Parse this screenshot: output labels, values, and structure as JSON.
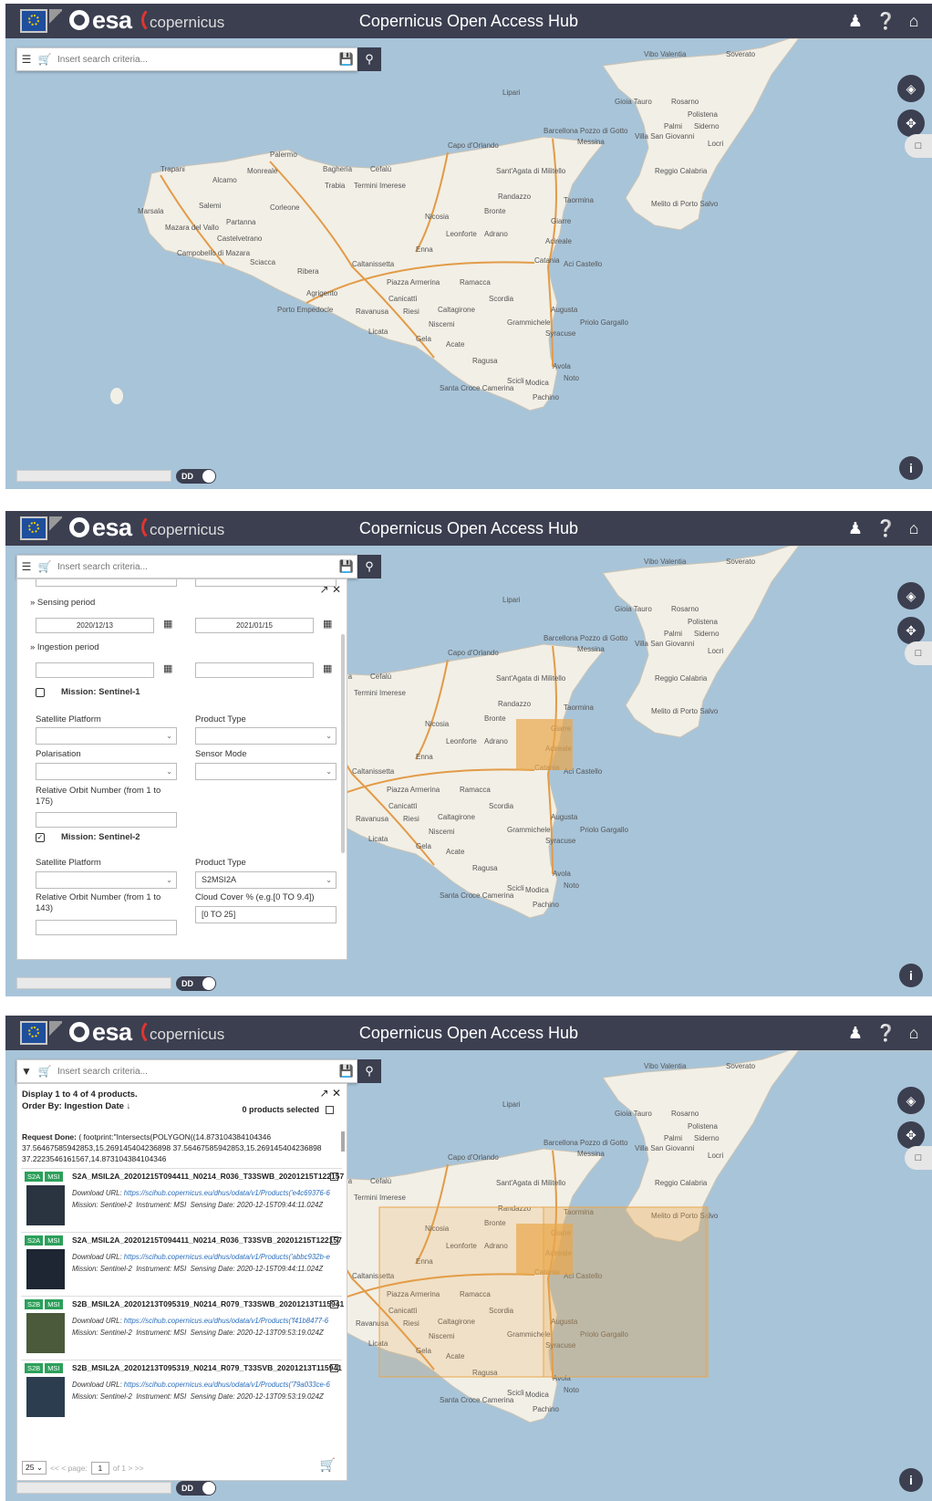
{
  "header": {
    "esa_label": "esa",
    "copernicus_label": "opernicus",
    "title": "Copernicus Open Access Hub"
  },
  "search": {
    "placeholder": "Insert search criteria..."
  },
  "toggle": {
    "label": "DD"
  },
  "map_labels": [
    {
      "t": "Vibo Valentia"
    },
    {
      "t": "Soverato"
    },
    {
      "t": "Lipari"
    },
    {
      "t": "Gioia Tauro"
    },
    {
      "t": "Rosarno"
    },
    {
      "t": "Polistena"
    },
    {
      "t": "Palmi"
    },
    {
      "t": "Siderno"
    },
    {
      "t": "Villa San Giovanni"
    },
    {
      "t": "Locri"
    },
    {
      "t": "Messina"
    },
    {
      "t": "Barcellona Pozzo di Gotto"
    },
    {
      "t": "Capo d'Orlando"
    },
    {
      "t": "Palermo"
    },
    {
      "t": "Bagheria"
    },
    {
      "t": "Cefalù"
    },
    {
      "t": "Trapani"
    },
    {
      "t": "Monreale"
    },
    {
      "t": "Alcamo"
    },
    {
      "t": "Trabia"
    },
    {
      "t": "Termini Imerese"
    },
    {
      "t": "Sant'Agata di Militello"
    },
    {
      "t": "Reggio Calabria"
    },
    {
      "t": "Marsala"
    },
    {
      "t": "Salemi"
    },
    {
      "t": "Corleone"
    },
    {
      "t": "Randazzo"
    },
    {
      "t": "Taormina"
    },
    {
      "t": "Melito di Porto Salvo"
    },
    {
      "t": "Mazara del Vallo"
    },
    {
      "t": "Partanna"
    },
    {
      "t": "Nicosia"
    },
    {
      "t": "Bronte"
    },
    {
      "t": "Giarre"
    },
    {
      "t": "Castelvetrano"
    },
    {
      "t": "Leonforte"
    },
    {
      "t": "Adrano"
    },
    {
      "t": "Acireale"
    },
    {
      "t": "Campobello di Mazara"
    },
    {
      "t": "Sciacca"
    },
    {
      "t": "Enna"
    },
    {
      "t": "Caltanissetta"
    },
    {
      "t": "Catania"
    },
    {
      "t": "Aci Castello"
    },
    {
      "t": "Ribera"
    },
    {
      "t": "Piazza Armerina"
    },
    {
      "t": "Ramacca"
    },
    {
      "t": "Agrigento"
    },
    {
      "t": "Canicattì"
    },
    {
      "t": "Scordia"
    },
    {
      "t": "Porto Empedocle"
    },
    {
      "t": "Ravanusa"
    },
    {
      "t": "Riesi"
    },
    {
      "t": "Caltagirone"
    },
    {
      "t": "Augusta"
    },
    {
      "t": "Niscemi"
    },
    {
      "t": "Grammichele"
    },
    {
      "t": "Priolo Gargallo"
    },
    {
      "t": "Licata"
    },
    {
      "t": "Gela"
    },
    {
      "t": "Syracuse"
    },
    {
      "t": "Acate"
    },
    {
      "t": "Ragusa"
    },
    {
      "t": "Avola"
    },
    {
      "t": "Noto"
    },
    {
      "t": "Santa Croce Camerina"
    },
    {
      "t": "Scicli"
    },
    {
      "t": "Modica"
    },
    {
      "t": "Pachino"
    }
  ],
  "advanced": {
    "sensing_period": "» Sensing period",
    "sensing_from": "2020/12/13",
    "sensing_to": "2021/01/15",
    "ingestion_period": "» Ingestion period",
    "mission1": "Mission: Sentinel-1",
    "satellite_platform": "Satellite Platform",
    "product_type": "Product Type",
    "polarisation": "Polarisation",
    "sensor_mode": "Sensor Mode",
    "rel_orbit_s1": "Relative Orbit Number (from 1 to 175)",
    "mission2": "Mission: Sentinel-2",
    "product_type_value": "S2MSI2A",
    "rel_orbit_s2": "Relative Orbit Number (from 1 to 143)",
    "cloud_cover": "Cloud Cover % (e.g.[0 TO 9.4])",
    "cloud_cover_value": "[0 TO 25]"
  },
  "results": {
    "display": "Display 1 to 4 of 4 products.",
    "order_by": "Order By: Ingestion Date",
    "selected": "0 products selected",
    "request_label": "Request Done:",
    "request_text": "( footprint:\"Intersects(POLYGON((14.873104384104346 37.56467585942853,15.269145404236898 37.56467585942853,15.269145404236898 37.2223546161567,14.873104384104346",
    "items": [
      {
        "badge1": "S2A",
        "badge2": "MSI",
        "name": "S2A_MSIL2A_20201215T094411_N0214_R036_T33SWB_20201215T122157",
        "url_label": "Download URL:",
        "url": "https://scihub.copernicus.eu/dhus/odata/v1/Products('e4c69376-6",
        "mission_label": "Mission:",
        "mission": "Sentinel-2",
        "instrument_label": "Instrument:",
        "instrument": "MSI",
        "sensing_label": "Sensing Date:",
        "sensing": "2020-12-15T09:44:11.024Z"
      },
      {
        "badge1": "S2A",
        "badge2": "MSI",
        "name": "S2A_MSIL2A_20201215T094411_N0214_R036_T33SVB_20201215T122157",
        "url_label": "Download URL:",
        "url": "https://scihub.copernicus.eu/dhus/odata/v1/Products('abbc932b-e",
        "mission_label": "Mission:",
        "mission": "Sentinel-2",
        "instrument_label": "Instrument:",
        "instrument": "MSI",
        "sensing_label": "Sensing Date:",
        "sensing": "2020-12-15T09:44:11.024Z"
      },
      {
        "badge1": "S2B",
        "badge2": "MSI",
        "name": "S2B_MSIL2A_20201213T095319_N0214_R079_T33SWB_20201213T115941",
        "url_label": "Download URL:",
        "url": "https://scihub.copernicus.eu/dhus/odata/v1/Products('f41b8477-6",
        "mission_label": "Mission:",
        "mission": "Sentinel-2",
        "instrument_label": "Instrument:",
        "instrument": "MSI",
        "sensing_label": "Sensing Date:",
        "sensing": "2020-12-13T09:53:19.024Z"
      },
      {
        "badge1": "S2B",
        "badge2": "MSI",
        "name": "S2B_MSIL2A_20201213T095319_N0214_R079_T33SVB_20201213T115941",
        "url_label": "Download URL:",
        "url": "https://scihub.copernicus.eu/dhus/odata/v1/Products('79a033ce-6",
        "mission_label": "Mission:",
        "mission": "Sentinel-2",
        "instrument_label": "Instrument:",
        "instrument": "MSI",
        "sensing_label": "Sensing Date:",
        "sensing": "2020-12-13T09:53:19.024Z"
      }
    ],
    "page_size": "25",
    "page_prefix": "<< < page:",
    "page_value": "1",
    "page_suffix": "of 1 > >>"
  },
  "colors": {
    "topbar": "#3b3f50",
    "sea": "#a8c4d9",
    "land": "#f2efe6",
    "badge": "#2ca05a",
    "footprint": "#e9a64a"
  },
  "icons": [
    "menu-icon",
    "cart-icon",
    "filter-icon",
    "save-icon",
    "search-icon",
    "user-icon",
    "help-icon",
    "home-icon",
    "layers-icon",
    "pan-icon",
    "extent-icon",
    "info-icon",
    "calendar-icon",
    "expand-icon",
    "close-icon",
    "sort-down-icon",
    "chevron-down-icon"
  ]
}
